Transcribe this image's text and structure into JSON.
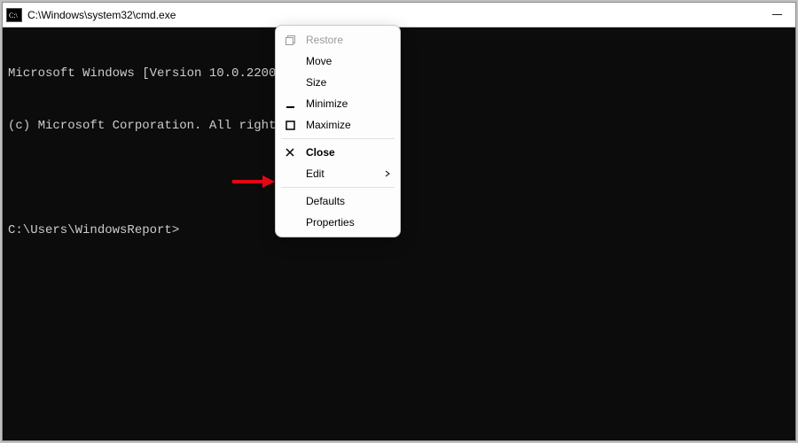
{
  "window": {
    "title": "C:\\Windows\\system32\\cmd.exe"
  },
  "terminal": {
    "line1": "Microsoft Windows [Version 10.0.22000.",
    "line2": "(c) Microsoft Corporation. All rights ",
    "prompt": "C:\\Users\\WindowsReport>"
  },
  "menu": {
    "restore": "Restore",
    "move": "Move",
    "size": "Size",
    "minimize": "Minimize",
    "maximize": "Maximize",
    "close": "Close",
    "edit": "Edit",
    "defaults": "Defaults",
    "properties": "Properties"
  },
  "colors": {
    "arrow": "#e30613"
  }
}
